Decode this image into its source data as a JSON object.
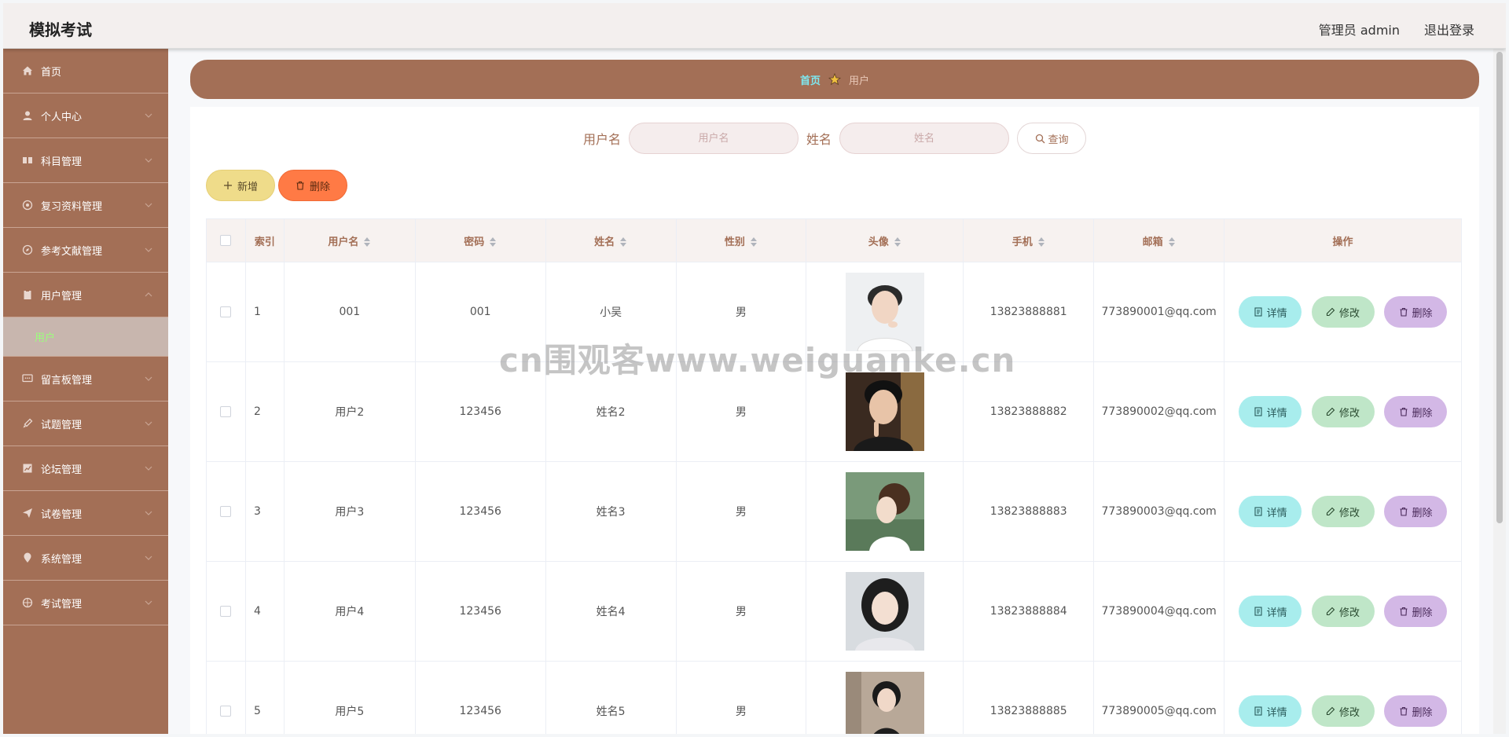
{
  "header": {
    "title": "模拟考试",
    "user": "管理员 admin",
    "logout": "退出登录"
  },
  "sidebar": {
    "items": [
      {
        "label": "首页",
        "icon": "home-icon"
      },
      {
        "label": "个人中心",
        "icon": "user-icon"
      },
      {
        "label": "科目管理",
        "icon": "grid-icon"
      },
      {
        "label": "复习资料管理",
        "icon": "chrome-icon"
      },
      {
        "label": "参考文献管理",
        "icon": "compass-icon"
      },
      {
        "label": "用户管理",
        "icon": "clipboard-icon"
      },
      {
        "label": "留言板管理",
        "icon": "chat-icon"
      },
      {
        "label": "试题管理",
        "icon": "brush-icon"
      },
      {
        "label": "论坛管理",
        "icon": "chart-icon"
      },
      {
        "label": "试卷管理",
        "icon": "send-icon"
      },
      {
        "label": "系统管理",
        "icon": "location-icon"
      },
      {
        "label": "考试管理",
        "icon": "basketball-icon"
      }
    ],
    "active_sub": "用户"
  },
  "breadcrumb": {
    "home": "首页",
    "current": "用户"
  },
  "search": {
    "username_label": "用户名",
    "username_placeholder": "用户名",
    "name_label": "姓名",
    "name_placeholder": "姓名",
    "button": "查询"
  },
  "actions": {
    "add": "新增",
    "delete": "删除"
  },
  "table": {
    "headers": [
      "索引",
      "用户名",
      "密码",
      "姓名",
      "性别",
      "头像",
      "手机",
      "邮箱",
      "操作"
    ],
    "rows": [
      {
        "index": "1",
        "username": "001",
        "password": "001",
        "name": "小吴",
        "gender": "男",
        "phone": "13823888881",
        "email": "773890001@qq.com"
      },
      {
        "index": "2",
        "username": "用户2",
        "password": "123456",
        "name": "姓名2",
        "gender": "男",
        "phone": "13823888882",
        "email": "773890002@qq.com"
      },
      {
        "index": "3",
        "username": "用户3",
        "password": "123456",
        "name": "姓名3",
        "gender": "男",
        "phone": "13823888883",
        "email": "773890003@qq.com"
      },
      {
        "index": "4",
        "username": "用户4",
        "password": "123456",
        "name": "姓名4",
        "gender": "男",
        "phone": "13823888884",
        "email": "773890004@qq.com"
      },
      {
        "index": "5",
        "username": "用户5",
        "password": "123456",
        "name": "姓名5",
        "gender": "男",
        "phone": "13823888885",
        "email": "773890005@qq.com"
      }
    ],
    "ops": {
      "detail": "详情",
      "edit": "修改",
      "delete": "删除"
    }
  },
  "watermark": "cn围观客www.weiguanke.cn",
  "colors": {
    "sidebar": "#a36f56",
    "header": "#f3efee",
    "accent_label": "#a36f56"
  }
}
